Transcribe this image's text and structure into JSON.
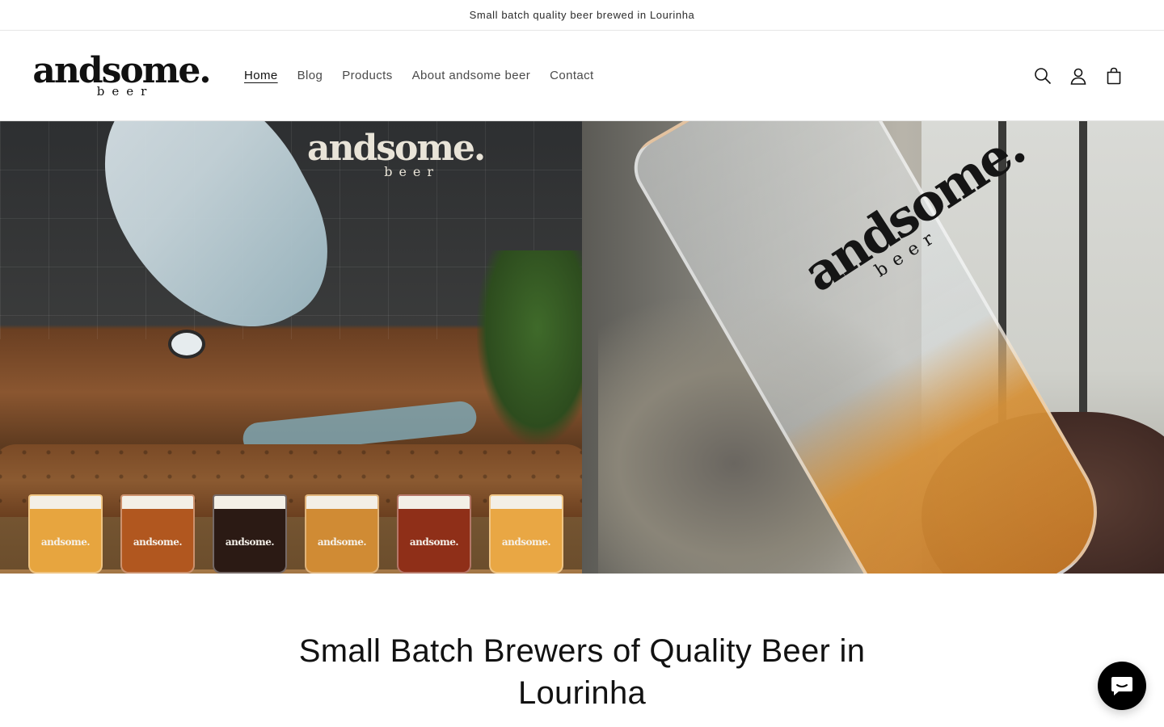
{
  "announcement": {
    "text": "Small batch quality beer brewed in Lourinha"
  },
  "header": {
    "logo": {
      "main": "andsome.",
      "sub": "beer"
    },
    "nav": [
      {
        "label": "Home",
        "active": true
      },
      {
        "label": "Blog",
        "active": false
      },
      {
        "label": "Products",
        "active": false
      },
      {
        "label": "About andsome beer",
        "active": false
      },
      {
        "label": "Contact",
        "active": false
      }
    ],
    "icons": [
      "search-icon",
      "account-icon",
      "cart-icon"
    ]
  },
  "hero": {
    "left_image": {
      "wall_logo_main": "andsome.",
      "wall_logo_sub": "beer",
      "glass_marks": [
        "andsome.",
        "andsome.",
        "andsome.",
        "andsome.",
        "andsome.",
        "andsome."
      ],
      "glass_colors": [
        "#e7a53f",
        "#b1571f",
        "#2b1a14",
        "#d08b34",
        "#8f2f18",
        "#e9a744"
      ]
    },
    "right_image": {
      "glass_logo_main": "andsome.",
      "glass_logo_sub": "beer"
    }
  },
  "main": {
    "title_line1": "Small Batch Brewers of Quality Beer in",
    "title_line2": "Lourinha"
  },
  "chat": {
    "icon": "chat-icon",
    "color": "#000000"
  }
}
